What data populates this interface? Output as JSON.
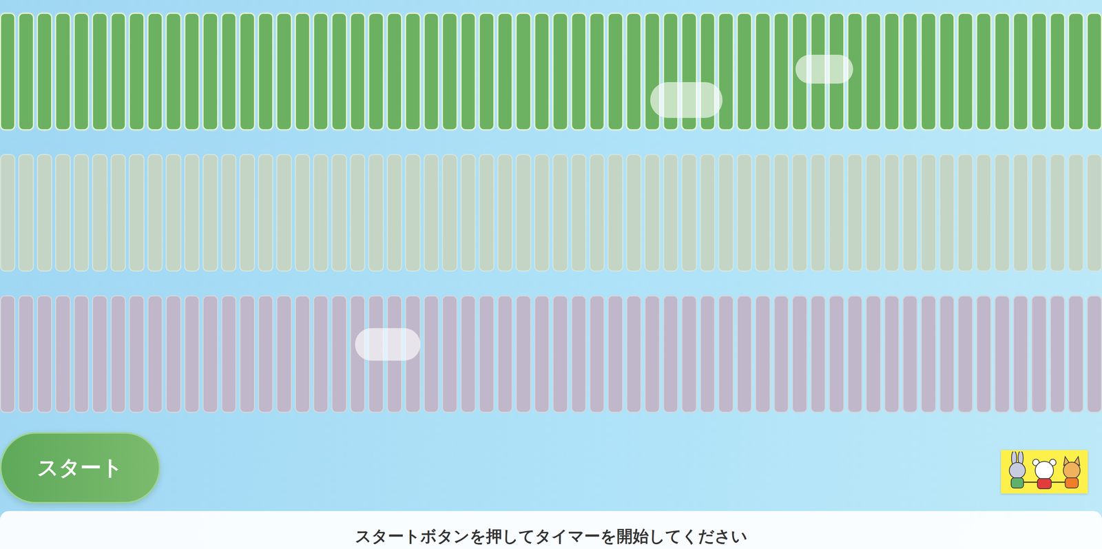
{
  "rows": [
    {
      "active": true,
      "color": "#6cb162",
      "segments": 60
    },
    {
      "active": false,
      "color": "#c4d5c5",
      "segments": 60
    },
    {
      "active": false,
      "color": "#c0b7ca",
      "segments": 60
    }
  ],
  "start_button": {
    "label": "スタート"
  },
  "status_bar": {
    "text": "スタートボタンを押してタイマーを開始してください"
  }
}
